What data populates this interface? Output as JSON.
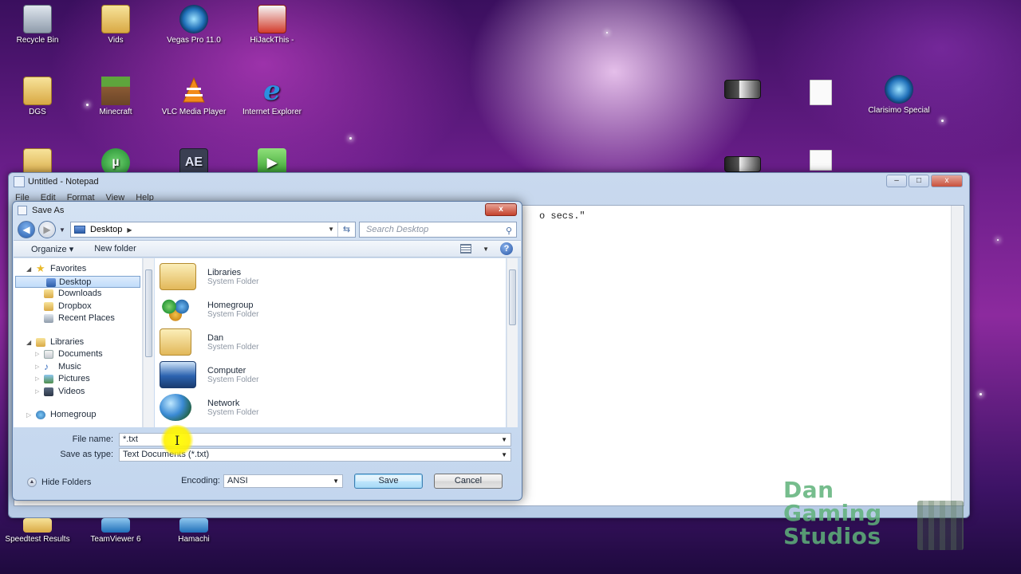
{
  "desktop": {
    "icons_row1": [
      {
        "label": "Recycle Bin",
        "icon": "recycle-bin-icon"
      },
      {
        "label": "Vids",
        "icon": "folder-icon"
      },
      {
        "label": "Vegas Pro 11.0",
        "icon": "vegas-icon"
      },
      {
        "label": "HiJackThis -",
        "icon": "hijackthis-icon"
      }
    ],
    "icons_row2": [
      {
        "label": "DGS",
        "icon": "folder-icon"
      },
      {
        "label": "Minecraft",
        "icon": "minecraft-icon"
      },
      {
        "label": "VLC Media Player",
        "icon": "vlc-icon"
      },
      {
        "label": "Internet Explorer",
        "icon": "ie-icon"
      }
    ],
    "icons_row3": [
      {
        "label": "AE",
        "icon": "after-effects-icon"
      }
    ],
    "icons_right": [
      {
        "label": "Clarisimo Special",
        "icon": "camera-icon"
      }
    ],
    "icons_bottom": [
      {
        "label": "Speedtest Results",
        "icon": "folder-icon"
      },
      {
        "label": "TeamViewer 6",
        "icon": "teamviewer-icon"
      },
      {
        "label": "Hamachi",
        "icon": "hamachi-icon"
      }
    ]
  },
  "notepad": {
    "title": "Untitled - Notepad",
    "menu": [
      "File",
      "Edit",
      "Format",
      "View",
      "Help"
    ],
    "visible_text": "o secs.\"",
    "controls": {
      "minimize": "–",
      "maximize": "□",
      "close": "x"
    }
  },
  "dialog": {
    "title": "Save As",
    "close": "x",
    "address": "Desktop",
    "search_placeholder": "Search Desktop",
    "toolbar": {
      "organize": "Organize ▾",
      "new_folder": "New folder",
      "help": "?"
    },
    "nav": {
      "favorites": {
        "label": "Favorites",
        "items": [
          "Desktop",
          "Downloads",
          "Dropbox",
          "Recent Places"
        ],
        "selected": "Desktop"
      },
      "libraries": {
        "label": "Libraries",
        "items": [
          "Documents",
          "Music",
          "Pictures",
          "Videos"
        ]
      },
      "homegroup": "Homegroup"
    },
    "files": [
      {
        "name": "Libraries",
        "type": "System Folder"
      },
      {
        "name": "Homegroup",
        "type": "System Folder"
      },
      {
        "name": "Dan",
        "type": "System Folder"
      },
      {
        "name": "Computer",
        "type": "System Folder"
      },
      {
        "name": "Network",
        "type": "System Folder"
      }
    ],
    "file_name_label": "File name:",
    "file_name_value": "*.txt",
    "save_type_label": "Save as type:",
    "save_type_value": "Text Documents (*.txt)",
    "encoding_label": "Encoding:",
    "encoding_value": "ANSI",
    "hide_folders": "Hide Folders",
    "save_button": "Save",
    "cancel_button": "Cancel"
  },
  "watermark": {
    "line1": "Dan",
    "line2": "Gaming",
    "line3": "Studios"
  },
  "colors": {
    "accent": "#2a5fae",
    "selection": "#c1dcfa",
    "highlight_cursor": "#fff200",
    "watermark": "#5fb27a"
  }
}
